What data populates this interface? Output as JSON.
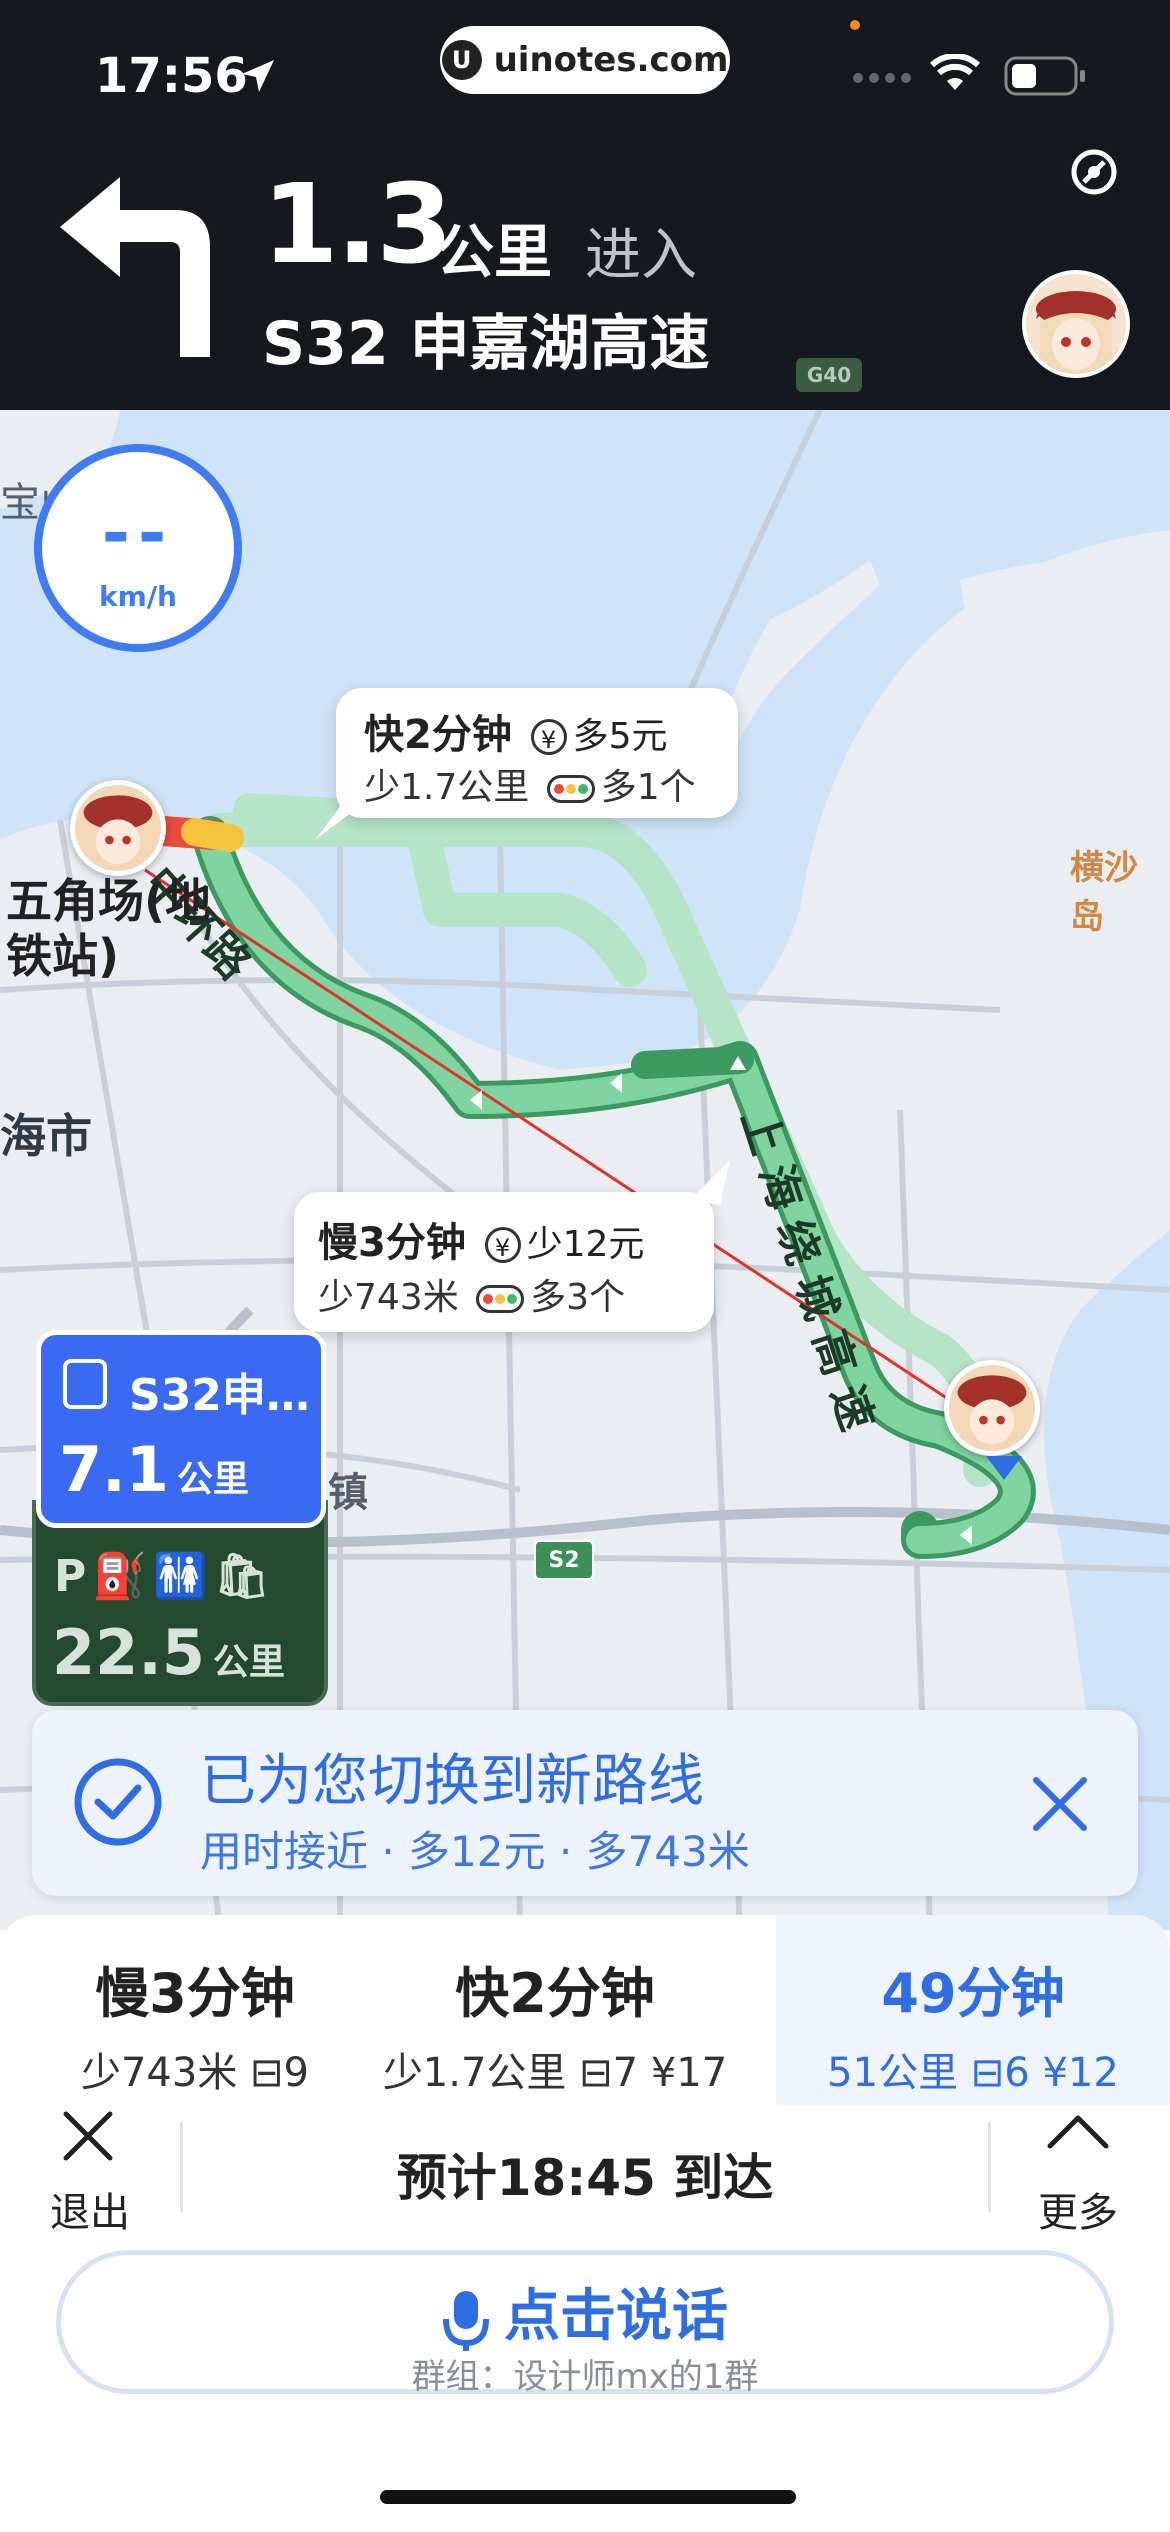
{
  "status_bar": {
    "time": "17:56",
    "url": "uinotes.com",
    "url_logo": "U"
  },
  "navigation": {
    "distance_value": "1.3",
    "distance_unit": "公里",
    "action": "进入",
    "road_name": "S32 申嘉湖高速",
    "road_sign": "G40"
  },
  "speed": {
    "value": "--",
    "unit": "km/h"
  },
  "map_labels": {
    "place_left": "五角场(地",
    "place_left_2": "铁站)",
    "city": "海市",
    "top_left": "宝山",
    "island": "横沙岛",
    "road_ring_inner": "中环路",
    "road_ring_outer": "上海绕城高速",
    "town": "镇",
    "sign_s2": "S2"
  },
  "bubbles": {
    "fast": {
      "time": "快2分钟",
      "cost": "多5元",
      "distance": "少1.7公里",
      "lights": "多1个"
    },
    "slow": {
      "time": "慢3分钟",
      "cost": "少12元",
      "distance": "少743米",
      "lights": "多3个"
    }
  },
  "highway_card": {
    "name": "S32申…",
    "distance": "7.1",
    "unit": "公里"
  },
  "service_card": {
    "distance": "22.5",
    "unit": "公里"
  },
  "notice": {
    "title": "已为您切换到新路线",
    "subtitle": "用时接近 · 多12元 · 多743米"
  },
  "route_options": [
    {
      "title": "慢3分钟",
      "detail": "少743米 ⊟9",
      "selected": false
    },
    {
      "title": "快2分钟",
      "detail": "少1.7公里 ⊟7 ¥17",
      "selected": false
    },
    {
      "title": "49分钟",
      "detail": "51公里 ⊟6 ¥12",
      "selected": true
    }
  ],
  "footer": {
    "exit_label": "退出",
    "eta": "预计18:45 到达",
    "more_label": "更多",
    "voice_main": "点击说话",
    "voice_sub": "群组：设计师mx的1群"
  },
  "colors": {
    "accent": "#2f6de2",
    "route": "#7fd4a0",
    "route_dark": "#3e9a62",
    "water": "#cfe4f8",
    "header_bg": "#15181c"
  }
}
